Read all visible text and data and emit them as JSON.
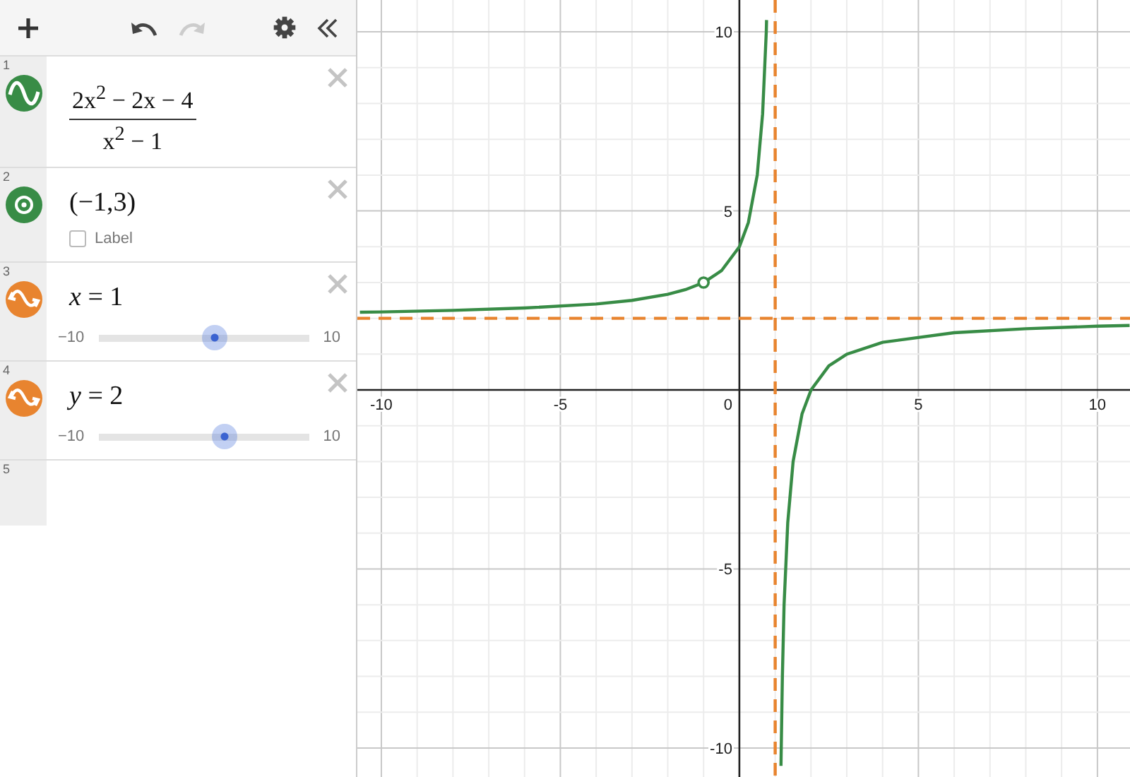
{
  "toolbar": {
    "undo": {
      "disabled": false
    },
    "redo": {
      "disabled": true
    }
  },
  "expressions": [
    {
      "number": "1",
      "kind": "function",
      "color": "#388c46",
      "numerator": "2x$^{2}$ − 2x − 4",
      "denominator": "x$^{2}$ − 1"
    },
    {
      "number": "2",
      "kind": "point",
      "color": "#388c46",
      "text": "(−1,3)",
      "label": {
        "text": "Label",
        "checked": false
      }
    },
    {
      "number": "3",
      "kind": "x-slider",
      "color": "#e8842f",
      "text": "*x* = 1",
      "min": "−10",
      "max": "10",
      "level": 0.55
    },
    {
      "number": "4",
      "kind": "y-slider",
      "color": "#e8842f",
      "text": "*y* = 2",
      "min": "−10",
      "max": "10",
      "level": 0.6
    },
    {
      "number": "5",
      "kind": "empty"
    }
  ],
  "graph": {
    "origin_label": "0",
    "chart_data": {
      "type": "line",
      "grid": true,
      "xlim": [
        -10.67,
        10.91
      ],
      "ylim": [
        -10.81,
        10.89
      ],
      "ref_lines": [
        {
          "axis": "x",
          "value": 1,
          "color": "#e8842f"
        },
        {
          "axis": "y",
          "value": 2,
          "color": "#e8842f"
        }
      ],
      "xticks": [
        -10,
        -5,
        5,
        10
      ],
      "yticks": [
        -10,
        -5,
        5,
        10
      ],
      "x": [
        -10.6,
        -10,
        -8,
        -6,
        -4,
        -3,
        -2,
        -1.5,
        -1,
        -0.5,
        0,
        0.25,
        0.5,
        0.65,
        0.75,
        0.76,
        1,
        1.16,
        1.2,
        1.25,
        1.35,
        1.5,
        1.75,
        2,
        2.5,
        3,
        4,
        6,
        8,
        10,
        10.9
      ],
      "series": [
        {
          "color": "#388c46",
          "values": [
            2.17,
            2.18,
            2.22,
            2.29,
            2.4,
            2.5,
            2.67,
            2.8,
            3,
            3.33,
            4,
            4.67,
            6,
            7.71,
            10,
            10.33,
            null,
            -10.5,
            -8,
            -6,
            -3.71,
            -2,
            -0.67,
            0,
            0.67,
            1,
            1.33,
            1.6,
            1.71,
            1.78,
            1.8
          ]
        },
        {
          "color": "#388c46",
          "marker": "open-circle",
          "values": [
            null,
            null,
            null,
            null,
            null,
            null,
            null,
            null,
            3,
            null,
            null,
            null,
            null,
            null,
            null,
            null,
            null,
            null,
            null,
            null,
            null,
            null,
            null,
            null,
            null,
            null,
            null,
            null,
            null,
            null,
            null
          ]
        }
      ]
    }
  }
}
